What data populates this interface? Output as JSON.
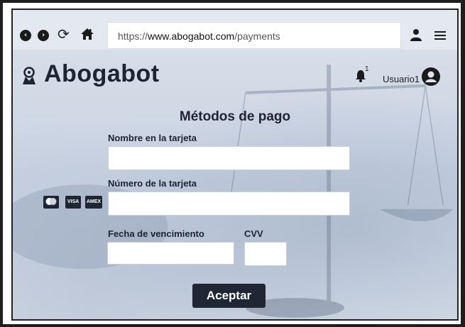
{
  "browser": {
    "url_prefix": "https://",
    "url_domain": "www.abogabot.com",
    "url_path": "/payments"
  },
  "header": {
    "brand": "Abogabot",
    "notification_count": "1",
    "username": "Usuario1"
  },
  "form": {
    "title": "Métodos de pago",
    "name_label": "Nombre en la tarjeta",
    "name_value": "",
    "number_label": "Número de la tarjeta",
    "number_value": "",
    "expiry_label": "Fecha de vencimiento",
    "expiry_value": "",
    "cvv_label": "CVV",
    "cvv_value": "",
    "accept_label": "Aceptar",
    "cards": [
      "mastercard",
      "VISA",
      "AMEX"
    ]
  },
  "colors": {
    "dark": "#1f2735",
    "toolbar": "#e4e9f1"
  }
}
